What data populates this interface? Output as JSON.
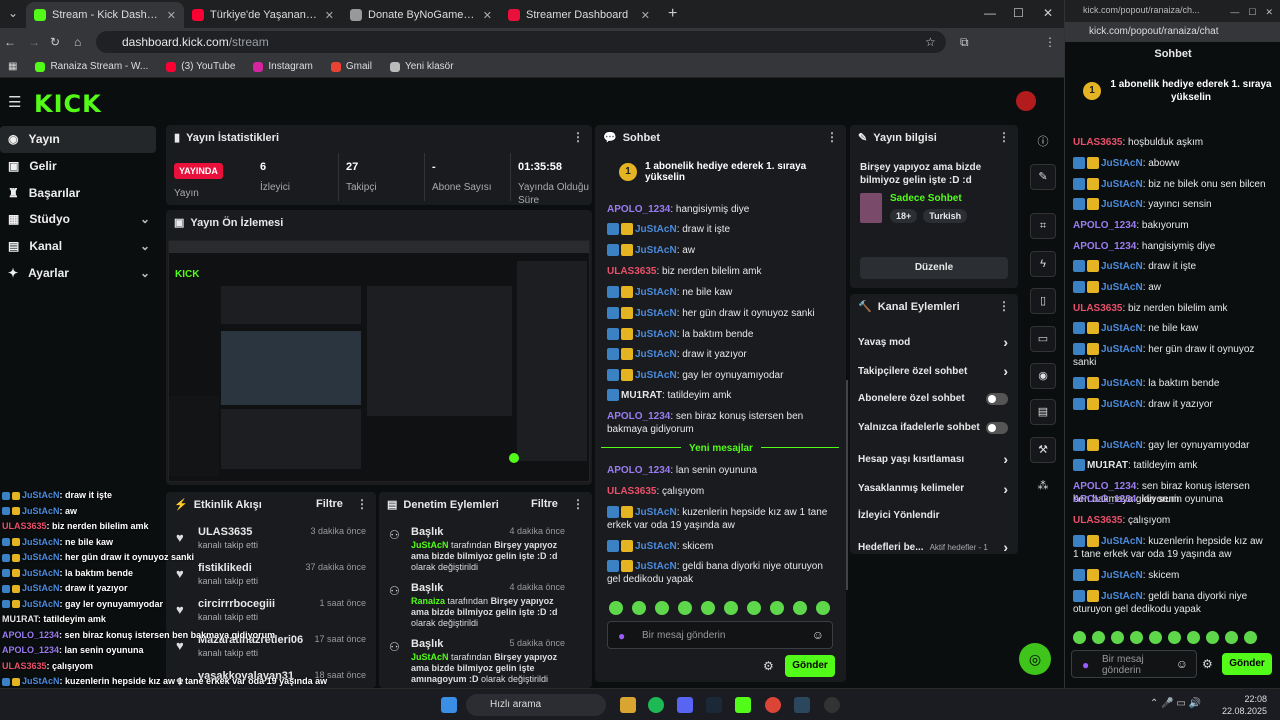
{
  "browser": {
    "tabs": [
      {
        "label": "Stream - Kick Dashboard",
        "color": "#53fc18"
      },
      {
        "label": "Türkiye'de Yaşanan Motorcu Ka",
        "color": "#ff0033"
      },
      {
        "label": "Donate ByNoGame - Gelen/Gid",
        "color": "#999999"
      },
      {
        "label": "Streamer Dashboard",
        "color": "#e9113c"
      }
    ],
    "url_host": "dashboard.kick.com",
    "url_path": "/stream",
    "bookmarks": [
      "Ranaiza Stream - W...",
      "(3) YouTube",
      "Instagram",
      "Gmail",
      "Yeni klasör"
    ]
  },
  "popout_browser": {
    "url": "kick.com/popout/ranaiza/ch...",
    "address": "kick.com/popout/ranaiza/chat"
  },
  "sidebar": {
    "items": [
      {
        "label": "Yayın",
        "icon": "broadcast-icon"
      },
      {
        "label": "Gelir",
        "icon": "wallet-icon"
      },
      {
        "label": "Başarılar",
        "icon": "trophy-icon"
      },
      {
        "label": "Stüdyo",
        "icon": "studio-icon"
      },
      {
        "label": "Kanal",
        "icon": "channel-icon"
      },
      {
        "label": "Ayarlar",
        "icon": "gear-icon"
      }
    ]
  },
  "stats": {
    "title": "Yayın İstatistikleri",
    "live_badge": "YAYINDA",
    "live_label": "Yayın",
    "items": [
      {
        "value": "6",
        "label": "İzleyici"
      },
      {
        "value": "27",
        "label": "Takipçi"
      },
      {
        "value": "-",
        "label": "Abone Sayısı"
      },
      {
        "value": "01:35:58",
        "label": "Yayında Olduğu Süre"
      }
    ]
  },
  "preview": {
    "title": "Yayın Ön İzlemesi"
  },
  "activity": {
    "title": "Etkinlik Akışı",
    "filter": "Filtre",
    "items": [
      {
        "name": "ULAS3635",
        "sub": "kanalı takip etti",
        "time": "3 dakika önce"
      },
      {
        "name": "fistiklikedi",
        "sub": "kanalı takip etti",
        "time": "37 dakika önce"
      },
      {
        "name": "circirrrbocegiii",
        "sub": "kanalı takip etti",
        "time": "1 saat önce"
      },
      {
        "name": "Mazaratihazretleri06",
        "sub": "kanalı takip etti",
        "time": "17 saat önce"
      },
      {
        "name": "yasakkovalayan31",
        "sub": "",
        "time": "18 saat önce"
      }
    ]
  },
  "moderation": {
    "title": "Denetim Eylemleri",
    "filter": "Filtre",
    "items": [
      {
        "heading": "Başlık",
        "user": "JuStAcN",
        "mid": " tarafından ",
        "text": "Birşey yapıyoz ama bizde bilmiyoz gelin işte :D :d",
        "end": " olarak değiştirildi",
        "time": "4 dakika önce"
      },
      {
        "heading": "Başlık",
        "user": "Ranaiza",
        "mid": " tarafından ",
        "text": "Birşey yapıyoz ama bizde bilmiyoz gelin işte :D :d",
        "end": " olarak değiştirildi",
        "time": "4 dakika önce"
      },
      {
        "heading": "Başlık",
        "user": "JuStAcN",
        "mid": " tarafından ",
        "text": "Birşey yapıyoz ama bizde bilmiyoz gelin işte amınagoyum :D",
        "end": " olarak değiştirildi",
        "time": "5 dakika önce"
      }
    ]
  },
  "chat": {
    "title": "Sohbet",
    "pinned": "1 abonelik hediye ederek 1. sıraya yükselin",
    "new_messages": "Yeni mesajlar",
    "placeholder": "Bir mesaj gönderin",
    "send": "Gönder",
    "messages": [
      {
        "user": "APOLO_1234",
        "text": ": hangisiymiş diye",
        "type": "p"
      },
      {
        "user": "JuStAcN",
        "text": ": draw it işte",
        "type": "b"
      },
      {
        "user": "JuStAcN",
        "text": ": aw",
        "type": "b"
      },
      {
        "user": "ULAS3635",
        "text": ": biz nerden bilelim amk",
        "type": "r"
      },
      {
        "user": "JuStAcN",
        "text": ": ne bile kaw",
        "type": "b"
      },
      {
        "user": "JuStAcN",
        "text": ": her gün draw it oynuyoz sanki",
        "type": "b"
      },
      {
        "user": "JuStAcN",
        "text": ": la baktım bende",
        "type": "b"
      },
      {
        "user": "JuStAcN",
        "text": ": draw it yazıyor",
        "type": "b"
      },
      {
        "user": "JuStAcN",
        "text": ": gay ler oynuyamıyodar",
        "type": "b"
      },
      {
        "user": "MU1RAT",
        "text": ": tatildeyim amk",
        "type": "w"
      },
      {
        "user": "APOLO_1234",
        "text": ": sen biraz konuş istersen ben bakmaya gidiyorum",
        "type": "p"
      },
      {
        "user": "APOLO_1234",
        "text": ": lan senin oyununa",
        "type": "p"
      },
      {
        "user": "ULAS3635",
        "text": ": çalışıyom",
        "type": "r"
      },
      {
        "user": "JuStAcN",
        "text": ": kuzenlerin hepside kız aw 1 tane erkek var oda 19 yaşında aw",
        "type": "b"
      },
      {
        "user": "JuStAcN",
        "text": ": skicem",
        "type": "b"
      },
      {
        "user": "JuStAcN",
        "text": ": geldi bana diyorki niye oturuyon gel dedikodu yapak",
        "type": "b"
      }
    ]
  },
  "info": {
    "title": "Yayın bilgisi",
    "stream_title": "Birşey yapıyoz ama bizde bilmiyoz gelin işte :D :d",
    "category": "Sadece Sohbet",
    "tags": [
      "18+",
      "Turkish"
    ],
    "edit": "Düzenle"
  },
  "actions": {
    "title": "Kanal Eylemleri",
    "items": [
      {
        "label": "Yavaş mod",
        "ctl": "chevron"
      },
      {
        "label": "Takipçilere özel sohbet",
        "ctl": "chevron"
      },
      {
        "label": "Abonelere özel sohbet",
        "ctl": "toggle"
      },
      {
        "label": "Yalnızca ifadelerle sohbet",
        "ctl": "toggle"
      },
      {
        "label": "Hesap yaşı kısıtlaması",
        "ctl": "chevron"
      },
      {
        "label": "Yasaklanmış kelimeler",
        "ctl": "chevron"
      },
      {
        "label": "İzleyici Yönlendir",
        "ctl": "none"
      },
      {
        "label": "Hedefleri be...",
        "ctl": "chevron",
        "extra": "Aktif hedefler - 1"
      }
    ]
  },
  "overlay": {
    "messages": [
      {
        "user": "JuStAcN",
        "text": ": draw it işte"
      },
      {
        "user": "JuStAcN",
        "text": ": aw"
      },
      {
        "user": "ULAS3635",
        "text": ": biz nerden bilelim amk"
      },
      {
        "user": "JuStAcN",
        "text": ": ne bile kaw"
      },
      {
        "user": "JuStAcN",
        "text": ": her gün draw it oynuyoz sanki"
      },
      {
        "user": "JuStAcN",
        "text": ": la baktım bende"
      },
      {
        "user": "JuStAcN",
        "text": ": draw it yazıyor"
      },
      {
        "user": "JuStAcN",
        "text": ": gay ler oynuyamıyodar"
      },
      {
        "user": "MU1RAT",
        "text": ": tatildeyim amk"
      },
      {
        "user": "APOLO_1234",
        "text": ": sen biraz konuş istersen ben bakmaya gidiyorum"
      },
      {
        "user": "APOLO_1234",
        "text": ": lan senin oyununa"
      },
      {
        "user": "ULAS3635",
        "text": ": çalışıyom"
      },
      {
        "user": "JuStAcN",
        "text": ": kuzenlerin hepside kız aw 1 tane erkek var oda 19 yaşında aw"
      },
      {
        "user": "JuStAcN",
        "text": ": skicem"
      },
      {
        "user": "JuStAcN",
        "text": ": geldi bana diyorki niye oturuyon gel dedikodu yapak"
      }
    ]
  },
  "popout_chat": {
    "title": "Sohbet",
    "pinned": "1 abonelik hediye ederek 1. sıraya yükselin",
    "placeholder": "Bir mesaj gönderin",
    "send": "Gönder",
    "messages": [
      {
        "user": "ULAS3635",
        "text": ": hoşbulduk aşkım",
        "type": "r"
      },
      {
        "user": "JuStAcN",
        "text": ": aboww",
        "type": "b"
      },
      {
        "user": "JuStAcN",
        "text": ": biz ne bilek onu sen bilcen",
        "type": "b"
      },
      {
        "user": "JuStAcN",
        "text": ": yayıncı sensin",
        "type": "b"
      },
      {
        "user": "APOLO_1234",
        "text": ": bakıyorum",
        "type": "p"
      },
      {
        "user": "APOLO_1234",
        "text": ": hangisiymiş diye",
        "type": "p"
      },
      {
        "user": "JuStAcN",
        "text": ": draw it işte",
        "type": "b"
      },
      {
        "user": "JuStAcN",
        "text": ": aw",
        "type": "b"
      },
      {
        "user": "ULAS3635",
        "text": ": biz nerden bilelim amk",
        "type": "r"
      },
      {
        "user": "JuStAcN",
        "text": ": ne bile kaw",
        "type": "b"
      },
      {
        "user": "JuStAcN",
        "text": ": her gün draw it oynuyoz sanki",
        "type": "b"
      },
      {
        "user": "JuStAcN",
        "text": ": la baktım bende",
        "type": "b"
      },
      {
        "user": "JuStAcN",
        "text": ": draw it yazıyor",
        "type": "b"
      },
      {
        "user": "JuStAcN",
        "text": ": gay ler oynuyamıyodar",
        "type": "b"
      },
      {
        "user": "MU1RAT",
        "text": ": tatildeyim amk",
        "type": "w"
      },
      {
        "user": "APOLO_1234",
        "text": ": sen biraz konuş istersen ben bakmaya gidiyorum",
        "type": "p"
      },
      {
        "user": "APOLO_1234",
        "text": ": lan senin oyununa",
        "type": "p"
      },
      {
        "user": "ULAS3635",
        "text": ": çalışıyom",
        "type": "r"
      },
      {
        "user": "JuStAcN",
        "text": ": kuzenlerin hepside kız aw 1 tane erkek var oda 19 yaşında aw",
        "type": "b"
      },
      {
        "user": "JuStAcN",
        "text": ": skicem",
        "type": "b"
      },
      {
        "user": "JuStAcN",
        "text": ": geldi bana diyorki niye oturuyon gel dedikodu yapak",
        "type": "b"
      }
    ]
  },
  "taskbar": {
    "search": "Hızlı arama",
    "time": "22:08",
    "date": "22.08.2025"
  },
  "colors": {
    "brand": "#53fc18",
    "live": "#e9113c",
    "panel": "#191b1f"
  }
}
